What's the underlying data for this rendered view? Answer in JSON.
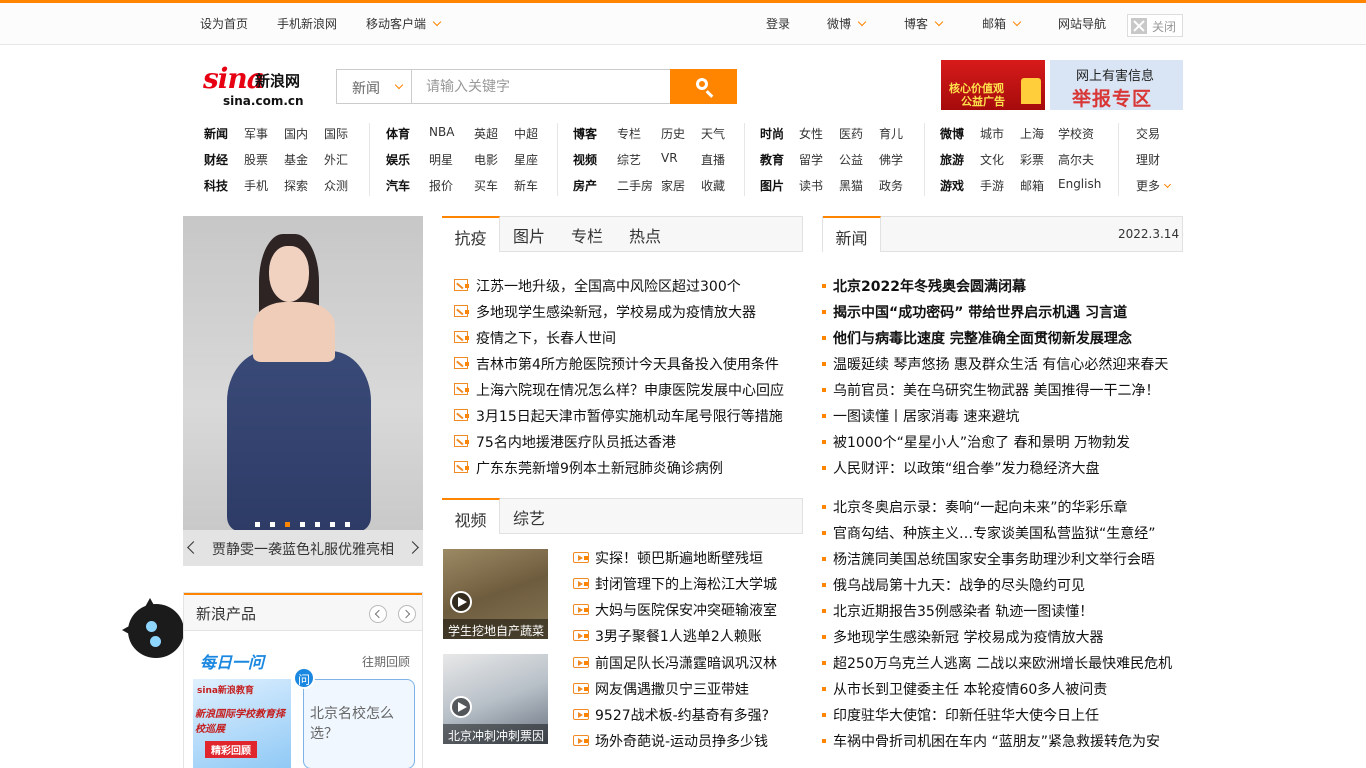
{
  "topbar": {
    "set_home": "设为首页",
    "mobile_sina": "手机新浪网",
    "mobile_client": "移动客户端",
    "login": "登录",
    "weibo": "微博",
    "blog": "博客",
    "mail": "邮箱",
    "site_nav": "网站导航",
    "close": "关闭",
    "accent": "#ff8400"
  },
  "logo": {
    "brand": "sina",
    "cn": "新浪网",
    "domain": "sina.com.cn"
  },
  "search": {
    "category": "新闻",
    "placeholder": "请输入关键字"
  },
  "banners": {
    "ad1_line1": "核心价值观",
    "ad1_line2": "公益广告",
    "ad2_line1": "网上有害信息",
    "ad2_line2": "举报专区"
  },
  "nav": {
    "g1": [
      [
        "新闻",
        "军事",
        "国内",
        "国际"
      ],
      [
        "财经",
        "股票",
        "基金",
        "外汇"
      ],
      [
        "科技",
        "手机",
        "探索",
        "众测"
      ]
    ],
    "g2": [
      [
        "体育",
        "NBA",
        "英超",
        "中超"
      ],
      [
        "娱乐",
        "明星",
        "电影",
        "星座"
      ],
      [
        "汽车",
        "报价",
        "买车",
        "新车"
      ]
    ],
    "g3": [
      [
        "博客",
        "专栏",
        "历史",
        "天气"
      ],
      [
        "视频",
        "综艺",
        "VR",
        "直播"
      ],
      [
        "房产",
        "二手房",
        "家居",
        "收藏"
      ]
    ],
    "g4": [
      [
        "时尚",
        "女性",
        "医药",
        "育儿"
      ],
      [
        "教育",
        "留学",
        "公益",
        "佛学"
      ],
      [
        "图片",
        "读书",
        "黑猫",
        "政务"
      ]
    ],
    "g5": [
      [
        "微博",
        "城市",
        "上海",
        "学校资"
      ],
      [
        "旅游",
        "文化",
        "彩票",
        "高尔夫"
      ],
      [
        "游戏",
        "手游",
        "邮箱",
        "English"
      ]
    ],
    "g6": [
      "交易",
      "理财",
      "更多"
    ]
  },
  "slideshow": {
    "caption": "贾静雯一袭蓝色礼服优雅亮相",
    "active_index": 3,
    "count": 7
  },
  "products": {
    "title": "新浪产品",
    "daily": "每日一问",
    "past": "往期回顾",
    "thumb_brand": "sina新浪教育",
    "thumb_title": "新浪国际学校教育择校巡展",
    "thumb_btn": "精彩回顾",
    "wen": "问",
    "question": "北京名校怎么选？"
  },
  "epidemic": {
    "tabs": [
      "抗疫",
      "图片",
      "专栏",
      "热点"
    ],
    "items": [
      "江苏一地升级，全国高中风险区超过300个",
      "多地现学生感染新冠，学校易成为疫情放大器",
      "疫情之下，长春人世间",
      "吉林市第4所方舱医院预计今天具备投入使用条件",
      "上海六院现在情况怎么样？申康医院发展中心回应",
      "3月15日起天津市暂停实施机动车尾号限行等措施",
      "75名内地援港医疗队员抵达香港",
      "广东东莞新增9例本土新冠肺炎确诊病例"
    ]
  },
  "video": {
    "tabs": [
      "视频",
      "综艺"
    ],
    "thumbs": [
      "学生挖地自产蔬菜",
      "北京冲刺冲刺票因"
    ],
    "items": [
      "实探！顿巴斯遍地断壁残垣",
      "封闭管理下的上海松江大学城",
      "大妈与医院保安冲突砸输液室",
      "3男子聚餐1人逃单2人赖账",
      "前国足队长冯潇霆暗讽巩汉林",
      "网友偶遇撒贝宁三亚带娃",
      "9527战术板-约基奇有多强?",
      "场外奇葩说-运动员挣多少钱"
    ]
  },
  "news": {
    "tab": "新闻",
    "date": "2022.3.14",
    "headlines": [
      "北京2022年冬残奥会圆满闭幕",
      "揭示中国“成功密码” 带给世界启示机遇 习言道",
      "他们与病毒比速度 完整准确全面贯彻新发展理念"
    ],
    "items1": [
      "温暖延续 琴声悠扬 惠及群众生活 有信心必然迎来春天",
      "乌前官员：美在乌研究生物武器 美国推得一干二净！",
      "一图读懂丨居家消毒 速来避坑",
      "被1000个“星星小人”治愈了 春和景明 万物勃发",
      "人民财评：以政策“组合拳”发力稳经济大盘"
    ],
    "items2": [
      "北京冬奥启示录：奏响“一起向未来”的华彩乐章",
      "官商勾结、种族主义…专家谈美国私营监狱“生意经”",
      "杨洁篪同美国总统国家安全事务助理沙利文举行会晤",
      "俄乌战局第十九天：战争的尽头隐约可见",
      "北京近期报告35例感染者 轨迹一图读懂！",
      "多地现学生感染新冠 学校易成为疫情放大器",
      "超250万乌克兰人逃离 二战以来欧洲增长最快难民危机",
      "从市长到卫健委主任 本轮疫情60多人被问责",
      "印度驻华大使馆：印新任驻华大使今日上任",
      "车祸中骨折司机困在车内 “蓝朋友”紧急救援转危为安"
    ]
  }
}
